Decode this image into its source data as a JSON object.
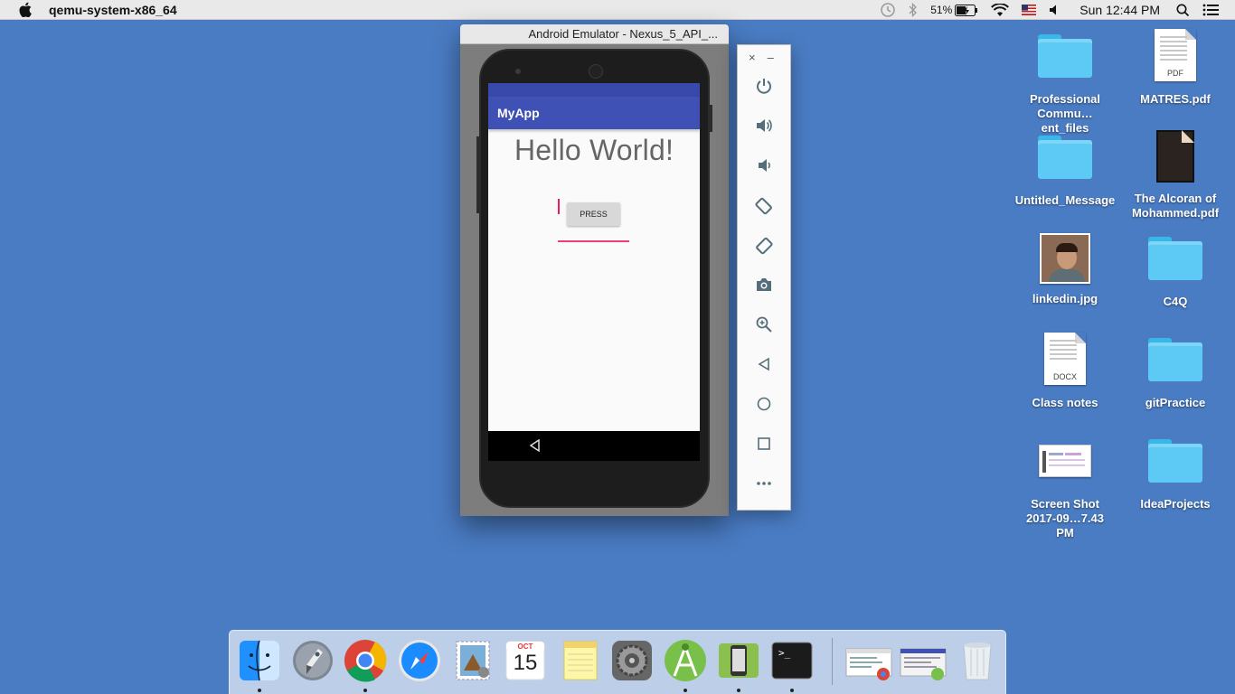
{
  "menubar": {
    "app_name": "qemu-system-x86_64",
    "battery_percent": "51%",
    "clock": "Sun 12:44 PM"
  },
  "emulator": {
    "window_title": "Android Emulator - Nexus_5_API_...",
    "app_title": "MyApp",
    "hello_text": "Hello World!",
    "press_button_label": "PRESS",
    "accent_color": "#3f51b5",
    "edit_accent_color": "#e91e63"
  },
  "emulator_toolbar": {
    "close_glyph": "×",
    "minimize_glyph": "–",
    "buttons": [
      "power-icon",
      "volume-up-icon",
      "volume-down-icon",
      "rotate-left-icon",
      "rotate-right-icon",
      "camera-icon",
      "zoom-icon",
      "back-icon",
      "home-icon",
      "overview-icon",
      "more-icon"
    ]
  },
  "desktop": {
    "icons": [
      {
        "label": "Professional Commu…ent_files",
        "kind": "folder"
      },
      {
        "label": "MATRES.pdf",
        "kind": "pdf",
        "tag": "PDF"
      },
      {
        "label": "Untitled_Message",
        "kind": "folder"
      },
      {
        "label": "The Alcoran of Mohammed.pdf",
        "kind": "book"
      },
      {
        "label": "linkedin.jpg",
        "kind": "photo"
      },
      {
        "label": "C4Q",
        "kind": "folder"
      },
      {
        "label": "Class notes",
        "kind": "docx",
        "tag": "DOCX"
      },
      {
        "label": "gitPractice",
        "kind": "folder"
      },
      {
        "label": "Screen Shot 2017-09…7.43 PM",
        "kind": "screenshot"
      },
      {
        "label": "IdeaProjects",
        "kind": "folder"
      }
    ]
  },
  "dock": {
    "items": [
      "finder-icon",
      "launchpad-icon",
      "chrome-icon",
      "safari-icon",
      "mail-icon",
      "calendar-icon",
      "notes-icon",
      "system-preferences-icon",
      "android-studio-icon",
      "android-device-manager-icon",
      "terminal-icon",
      "chrome-window-thumbnail",
      "android-studio-window-thumbnail",
      "trash-icon"
    ],
    "calendar_month": "OCT",
    "calendar_day": "15",
    "terminal_prompt": ">_"
  }
}
